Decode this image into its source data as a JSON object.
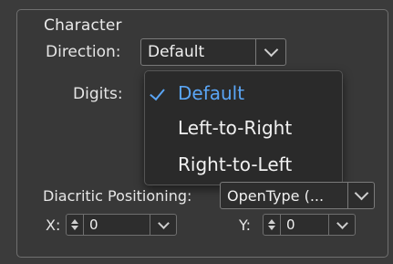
{
  "section": {
    "title": "Character"
  },
  "direction": {
    "label": "Direction:",
    "value": "Default"
  },
  "digits": {
    "label": "Digits:"
  },
  "dropdown_menu": {
    "items": [
      {
        "label": "Default",
        "selected": true
      },
      {
        "label": "Left-to-Right",
        "selected": false
      },
      {
        "label": "Right-to-Left",
        "selected": false
      }
    ]
  },
  "diacritic": {
    "label": "Diacritic Positioning:",
    "value": "OpenType (..."
  },
  "x_offset": {
    "label": "X:",
    "value": "0"
  },
  "y_offset": {
    "label": "Y:",
    "value": "0"
  },
  "colors": {
    "selected": "#5aa5f5",
    "background": "#3b3b3b"
  },
  "icons": {
    "chevron": "chevron-down-icon",
    "check": "check-icon",
    "stepper": "stepper-arrows-icon"
  }
}
